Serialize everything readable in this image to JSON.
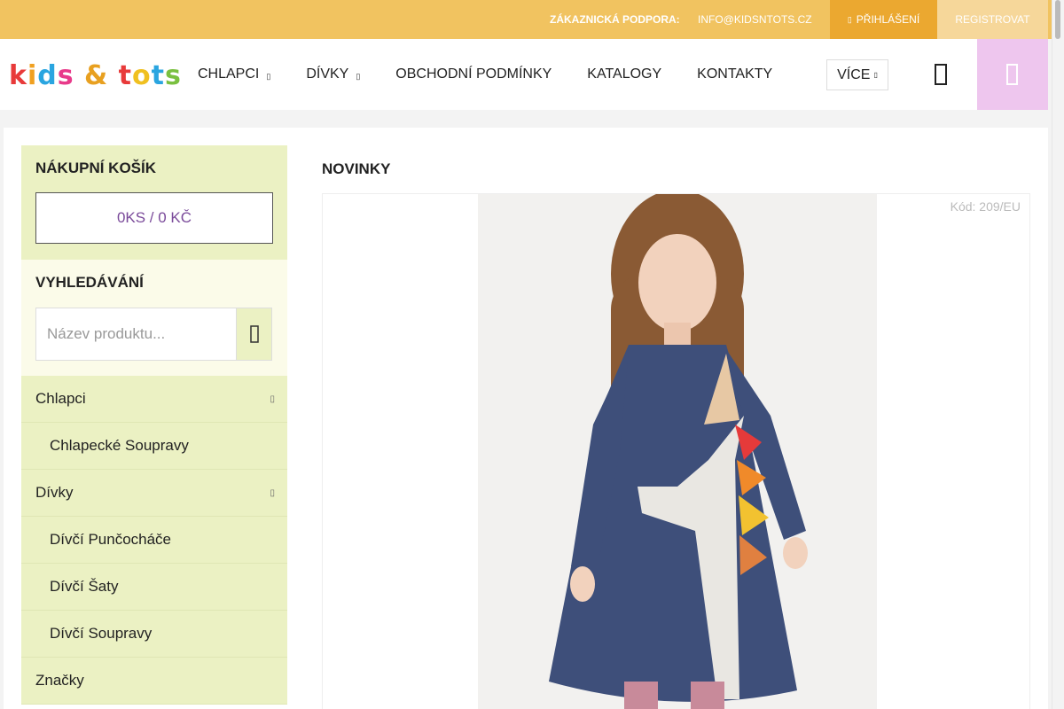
{
  "topbar": {
    "support_label": "ZÁKAZNICKÁ PODPORA:",
    "email": "INFO@KIDSNTOTS.CZ",
    "login": "PŘIHLÁŠENÍ",
    "register": "REGISTROVAT"
  },
  "header": {
    "logo": "kids & tots",
    "nav": [
      "CHLAPCI",
      "DÍVKY",
      "OBCHODNÍ PODMÍNKY",
      "KATALOGY",
      "KONTAKTY"
    ],
    "more": "VÍCE"
  },
  "sidebar": {
    "cart_title": "NÁKUPNÍ KOŠÍK",
    "cart_summary": "0KS / 0 KČ",
    "search_title": "VYHLEDÁVÁNÍ",
    "search_placeholder": "Název produktu...",
    "categories": [
      {
        "label": "Chlapci",
        "sub": false,
        "expandable": true
      },
      {
        "label": "Chlapecké Soupravy",
        "sub": true,
        "expandable": false
      },
      {
        "label": "Dívky",
        "sub": false,
        "expandable": true
      },
      {
        "label": "Dívčí Punčocháče",
        "sub": true,
        "expandable": false
      },
      {
        "label": "Dívčí Šaty",
        "sub": true,
        "expandable": false
      },
      {
        "label": "Dívčí Soupravy",
        "sub": true,
        "expandable": false
      },
      {
        "label": "Značky",
        "sub": false,
        "expandable": false
      }
    ]
  },
  "main": {
    "title": "NOVINKY",
    "product_code": "Kód: 209/EU"
  },
  "colors": {
    "topbar": "#f1c360",
    "login_bg": "#eba830",
    "cart_bg": "#eec6ee",
    "sidebar_green": "#ebf1c3"
  }
}
